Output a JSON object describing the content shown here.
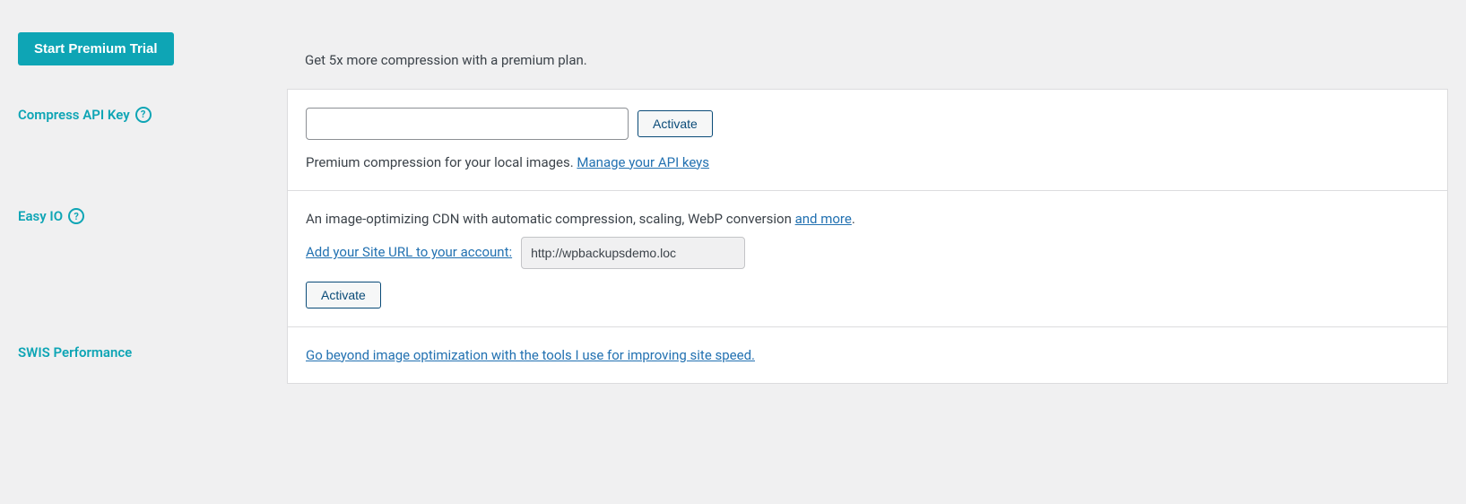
{
  "premium": {
    "button_label": "Start Premium Trial",
    "description": "Get 5x more compression with a premium plan."
  },
  "compress_api": {
    "label": "Compress API Key",
    "activate_label": "Activate",
    "input_value": "",
    "description_prefix": "Premium compression for your local images. ",
    "manage_link": "Manage your API keys"
  },
  "easy_io": {
    "label": "Easy IO",
    "description_prefix": "An image-optimizing CDN with automatic compression, scaling, WebP conversion ",
    "and_more_link": "and more",
    "description_suffix": ".",
    "add_url_link": "Add your Site URL to your account:",
    "site_url_value": "http://wpbackupsdemo.loc",
    "activate_label": "Activate"
  },
  "swis": {
    "label": "SWIS Performance",
    "link_text": "Go beyond image optimization with the tools I use for improving site speed."
  }
}
